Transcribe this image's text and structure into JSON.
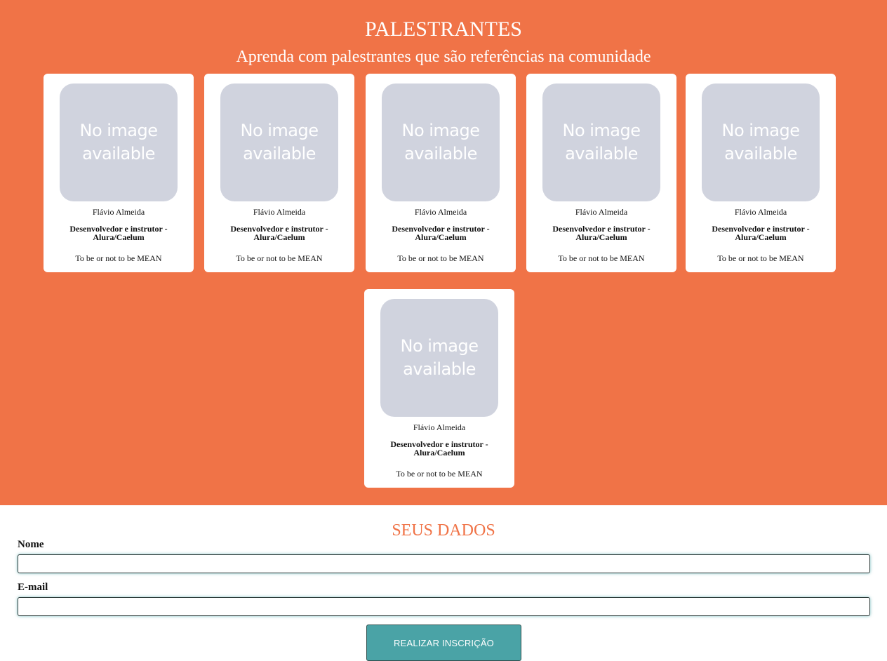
{
  "speakers": {
    "title": "PALESTRANTES",
    "subtitle": "Aprenda com palestrantes que são referências na comunidade",
    "cards": [
      {
        "photo_text": "No image available",
        "name": "Flávio Almeida",
        "role": "Desenvolvedor e instrutor - Alura/Caelum",
        "talk": "To be or not to be MEAN"
      },
      {
        "photo_text": "No image available",
        "name": "Flávio Almeida",
        "role": "Desenvolvedor e instrutor - Alura/Caelum",
        "talk": "To be or not to be MEAN"
      },
      {
        "photo_text": "No image available",
        "name": "Flávio Almeida",
        "role": "Desenvolvedor e instrutor - Alura/Caelum",
        "talk": "To be or not to be MEAN"
      },
      {
        "photo_text": "No image available",
        "name": "Flávio Almeida",
        "role": "Desenvolvedor e instrutor - Alura/Caelum",
        "talk": "To be or not to be MEAN"
      },
      {
        "photo_text": "No image available",
        "name": "Flávio Almeida",
        "role": "Desenvolvedor e instrutor - Alura/Caelum",
        "talk": "To be or not to be MEAN"
      },
      {
        "photo_text": "No image available",
        "name": "Flávio Almeida",
        "role": "Desenvolvedor e instrutor - Alura/Caelum",
        "talk": "To be or not to be MEAN"
      }
    ]
  },
  "form": {
    "title": "SEUS DADOS",
    "name_label": "Nome",
    "name_value": "",
    "email_label": "E-mail",
    "email_value": "",
    "submit_label": "REALIZAR INSCRIÇÃO"
  },
  "colors": {
    "accent": "#f07347",
    "button": "#4aa3a6",
    "placeholder_image": "#d0d3de"
  }
}
